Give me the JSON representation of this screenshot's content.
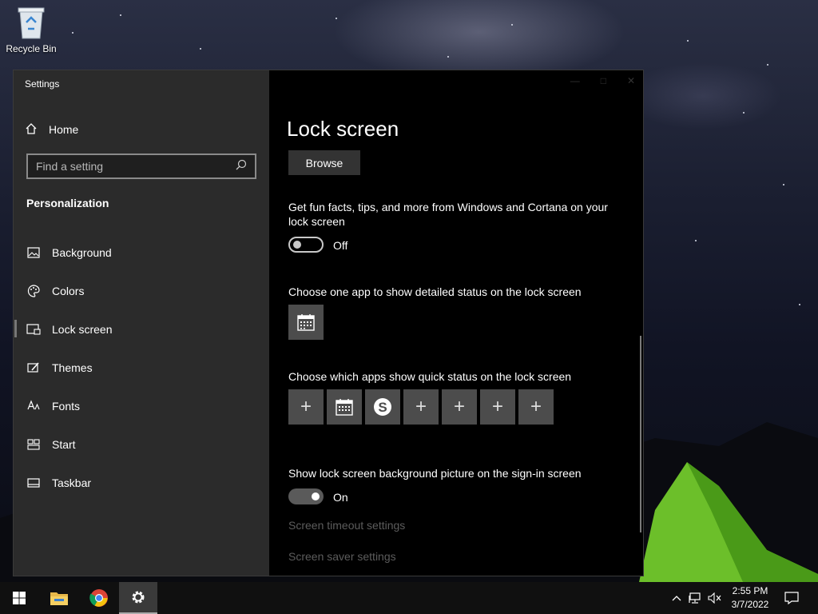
{
  "desktop": {
    "recycle_bin_label": "Recycle Bin"
  },
  "window": {
    "title": "Settings"
  },
  "sidebar": {
    "home_label": "Home",
    "search_placeholder": "Find a setting",
    "section_title": "Personalization",
    "items": [
      {
        "label": "Background",
        "icon": "image-icon"
      },
      {
        "label": "Colors",
        "icon": "palette-icon"
      },
      {
        "label": "Lock screen",
        "icon": "lock-screen-icon",
        "active": true
      },
      {
        "label": "Themes",
        "icon": "brush-icon"
      },
      {
        "label": "Fonts",
        "icon": "font-icon"
      },
      {
        "label": "Start",
        "icon": "start-grid-icon"
      },
      {
        "label": "Taskbar",
        "icon": "taskbar-icon"
      }
    ]
  },
  "main": {
    "title": "Lock screen",
    "browse_label": "Browse",
    "fun_facts_text": "Get fun facts, tips, and more from Windows and Cortana on your lock screen",
    "fun_facts_state": "Off",
    "detailed_status_label": "Choose one app to show detailed status on the lock screen",
    "quick_status_label": "Choose which apps show quick status on the lock screen",
    "quick_status_tiles": [
      "add-icon",
      "calendar-icon",
      "skype-icon",
      "add-icon",
      "add-icon",
      "add-icon",
      "add-icon"
    ],
    "signin_bg_label": "Show lock screen background picture on the sign-in screen",
    "signin_bg_state": "On",
    "timeout_link": "Screen timeout settings",
    "saver_link": "Screen saver settings"
  },
  "taskbar": {
    "time": "2:55 PM",
    "date": "3/7/2022"
  }
}
